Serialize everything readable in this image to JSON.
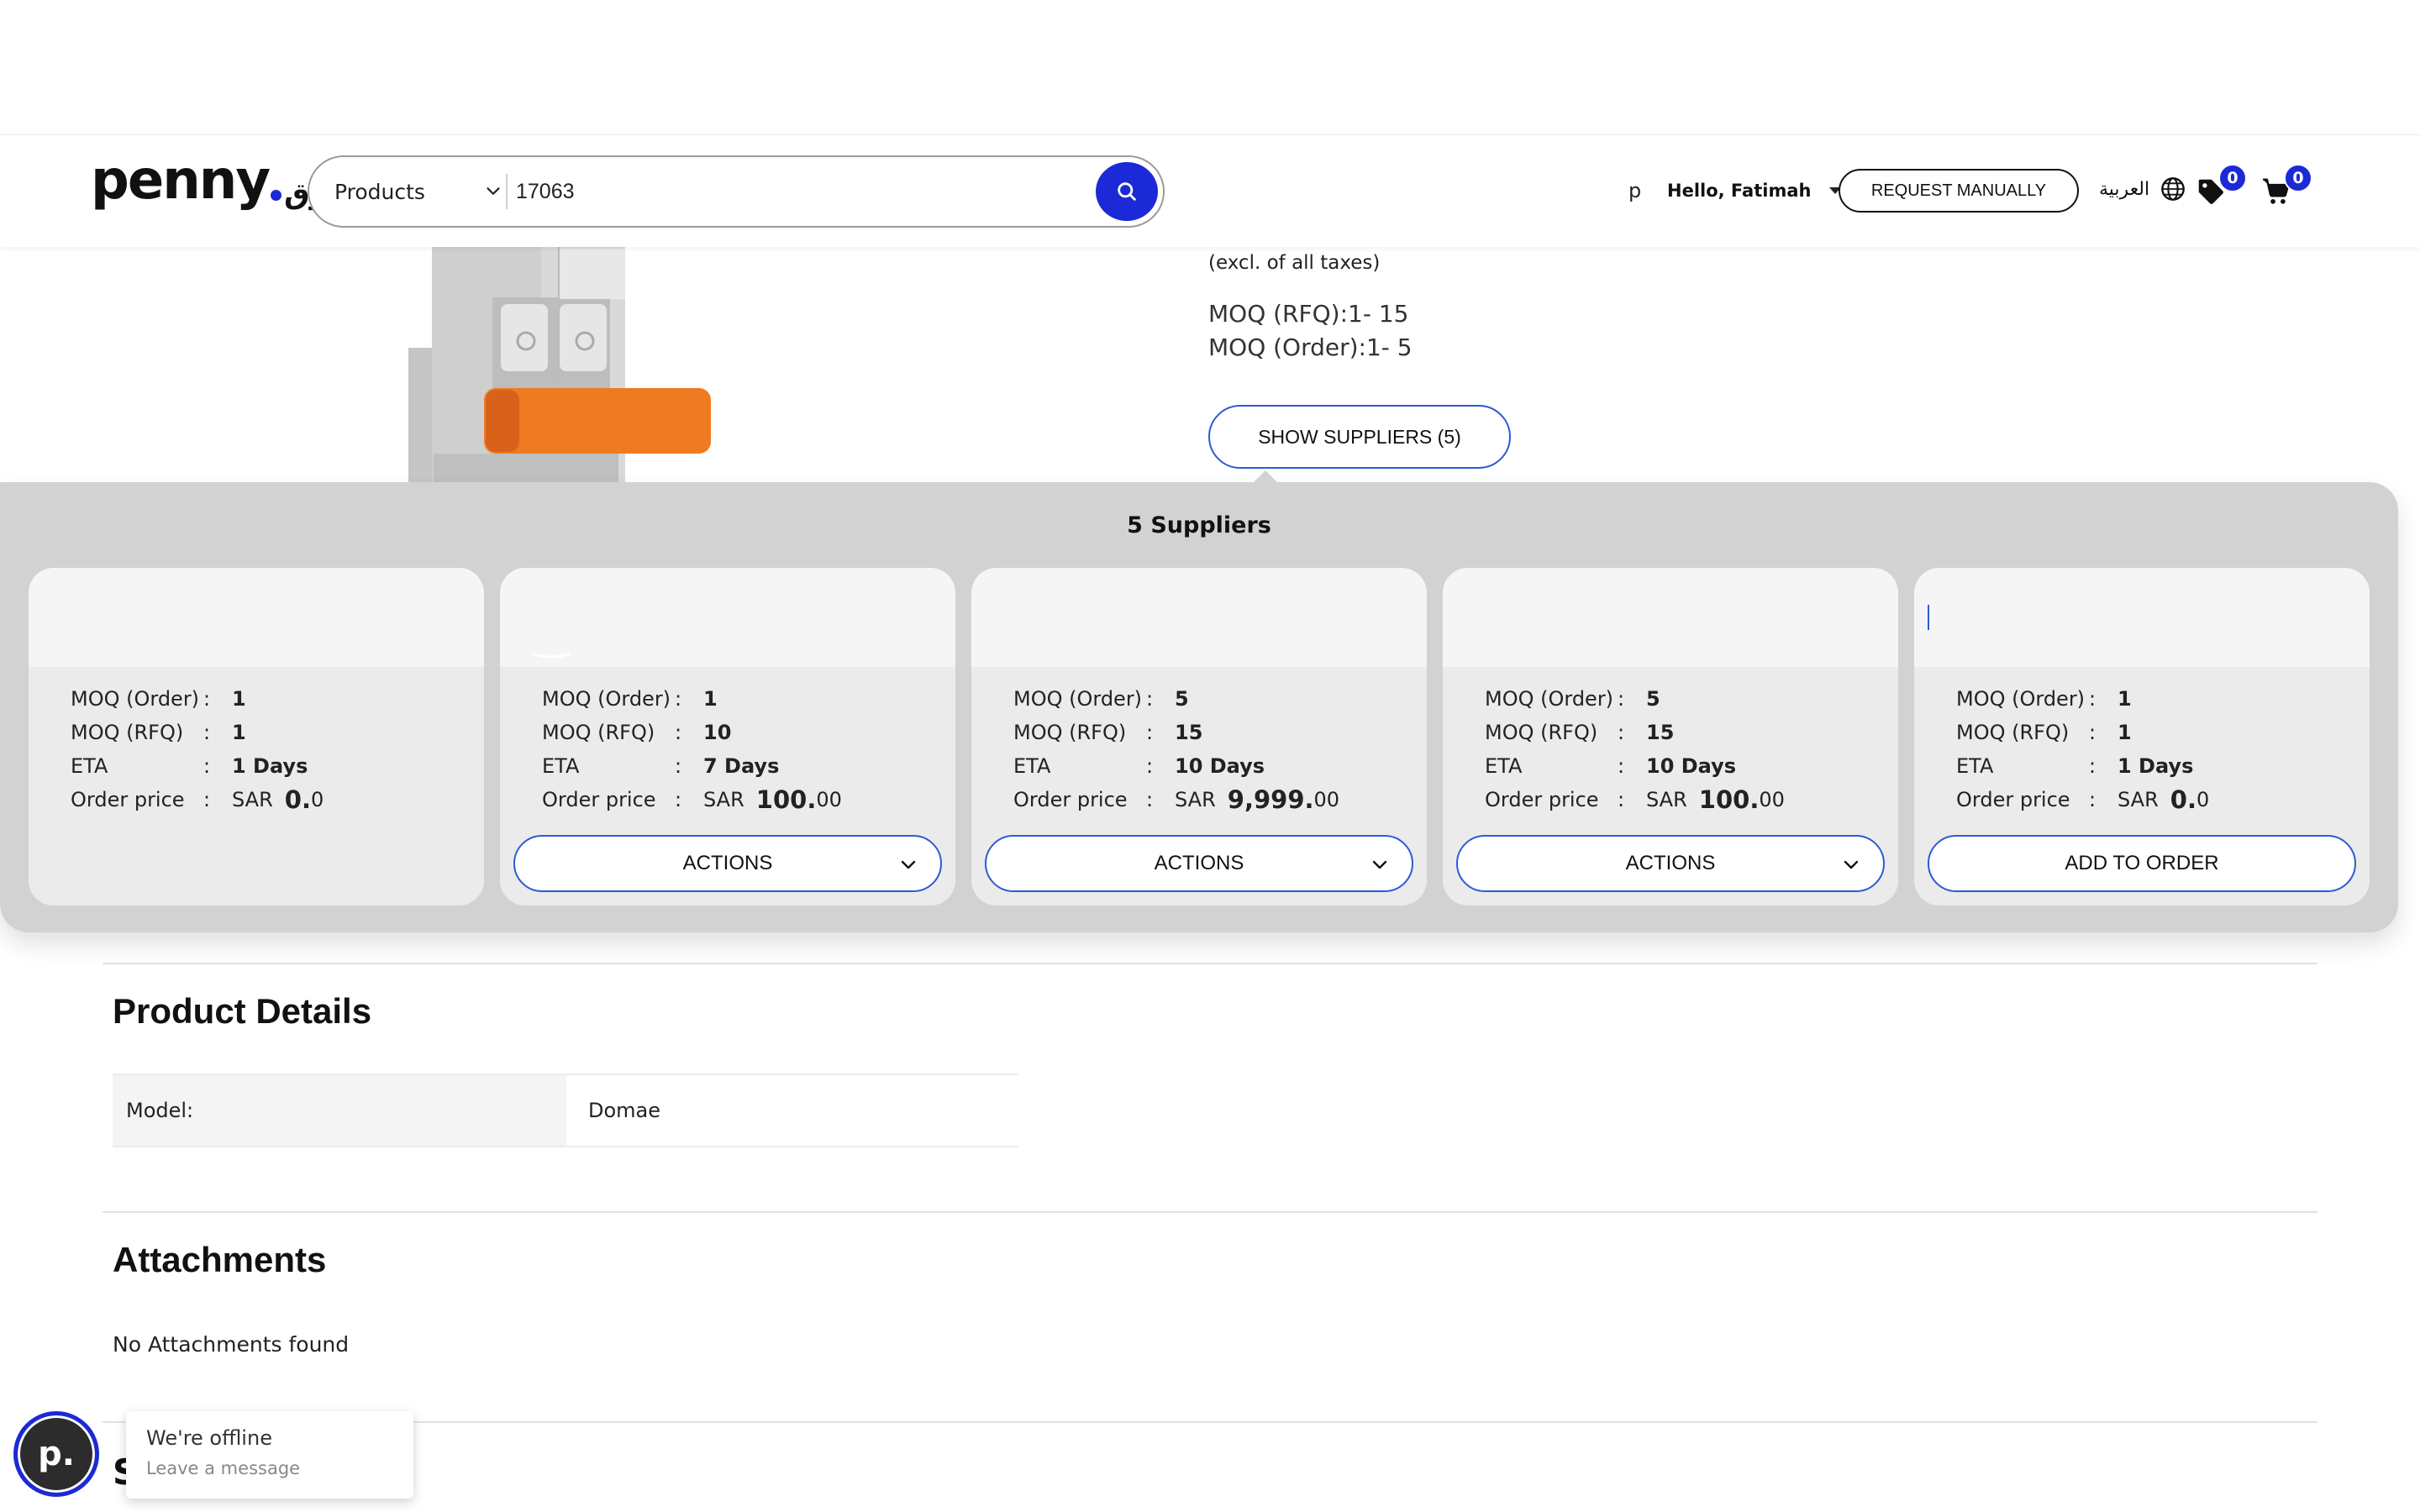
{
  "header": {
    "logo_text": "penny",
    "logo_arabic": "سوق",
    "search": {
      "category": "Products",
      "query": "17063"
    },
    "user_initial": "p",
    "greeting": "Hello, Fatimah",
    "request_manually_label": "REQUEST MANUALLY",
    "language_label": "العربية",
    "wishlist_count": "0",
    "cart_count": "0",
    "brand_color": "#1b2ad6"
  },
  "product": {
    "tax_note": "(excl. of all taxes)",
    "moq_rfq": "MOQ (RFQ):1- 15",
    "moq_order": "MOQ (Order):1- 5",
    "show_suppliers_label": "SHOW SUPPLIERS (5)"
  },
  "suppliers_panel": {
    "title": "5 Suppliers",
    "field_labels": {
      "moq_order": "MOQ (Order)",
      "moq_rfq": "MOQ (RFQ)",
      "eta": "ETA",
      "order_price": "Order price",
      "separator": ":",
      "currency": "SAR"
    },
    "suppliers": [
      {
        "moq_order": "1",
        "moq_rfq": "1",
        "eta": "1 Days",
        "price_int": "0.",
        "price_dec": "0",
        "button": ""
      },
      {
        "moq_order": "1",
        "moq_rfq": "10",
        "eta": "7 Days",
        "price_int": "100.",
        "price_dec": "00",
        "button": "ACTIONS"
      },
      {
        "moq_order": "5",
        "moq_rfq": "15",
        "eta": "10 Days",
        "price_int": "9,999.",
        "price_dec": "00",
        "button": "ACTIONS"
      },
      {
        "moq_order": "5",
        "moq_rfq": "15",
        "eta": "10 Days",
        "price_int": "100.",
        "price_dec": "00",
        "button": "ACTIONS"
      },
      {
        "moq_order": "1",
        "moq_rfq": "1",
        "eta": "1 Days",
        "price_int": "0.",
        "price_dec": "0",
        "button": "ADD TO ORDER"
      }
    ]
  },
  "product_details": {
    "title": "Product Details",
    "rows": [
      {
        "label": "Model:",
        "value": "Domae"
      }
    ]
  },
  "attachments": {
    "title": "Attachments",
    "empty_text": "No Attachments found"
  },
  "next_section_fragment": "S",
  "chat": {
    "avatar_letter": "p.",
    "status": "We're offline",
    "subtext": "Leave a message"
  }
}
